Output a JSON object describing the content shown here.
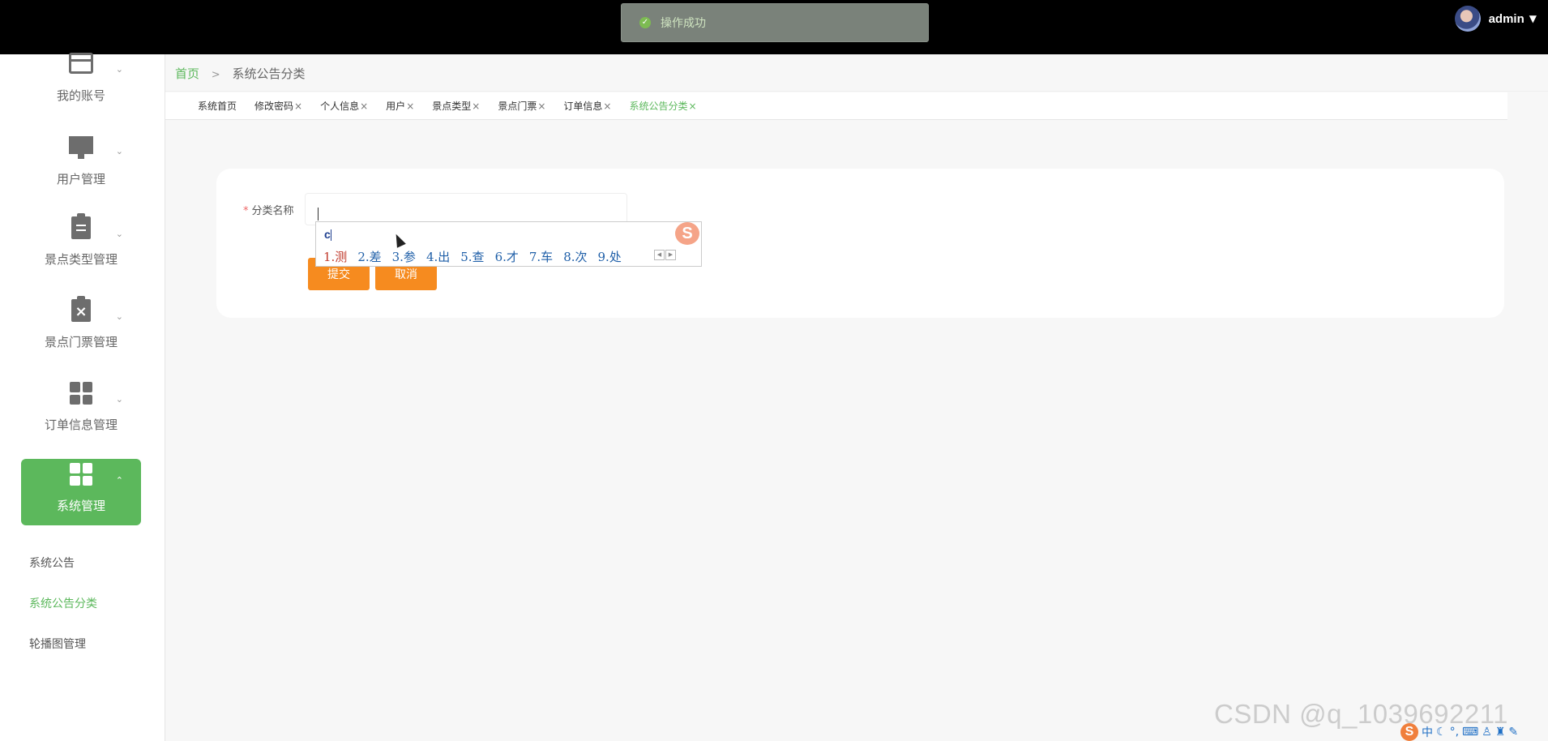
{
  "toast": {
    "text": "操作成功"
  },
  "user": {
    "name": "admin"
  },
  "sidebar": {
    "items": [
      {
        "label": "我的账号",
        "icon": "card-icon"
      },
      {
        "label": "用户管理",
        "icon": "monitor-icon"
      },
      {
        "label": "景点类型管理",
        "icon": "clipboard-icon"
      },
      {
        "label": "景点门票管理",
        "icon": "clipboard-x-icon"
      },
      {
        "label": "订单信息管理",
        "icon": "grid-icon"
      },
      {
        "label": "系统管理",
        "icon": "grid-icon",
        "active": true
      }
    ],
    "sub_items": [
      {
        "label": "系统公告"
      },
      {
        "label": "系统公告分类",
        "active": true
      },
      {
        "label": "轮播图管理"
      }
    ]
  },
  "breadcrumb": {
    "home": "首页",
    "separator": ">",
    "current": "系统公告分类"
  },
  "tabs": [
    {
      "label": "系统首页",
      "closable": false
    },
    {
      "label": "修改密码",
      "closable": true
    },
    {
      "label": "个人信息",
      "closable": true
    },
    {
      "label": "用户",
      "closable": true
    },
    {
      "label": "景点类型",
      "closable": true
    },
    {
      "label": "景点门票",
      "closable": true
    },
    {
      "label": "订单信息",
      "closable": true
    },
    {
      "label": "系统公告分类",
      "closable": true,
      "active": true
    }
  ],
  "tab_close_glyph": "×",
  "form": {
    "required_mark": "*",
    "category_label": "分类名称",
    "category_value": "",
    "submit_label": "提交",
    "cancel_label": "取消"
  },
  "ime": {
    "input": "c",
    "logo": "S",
    "candidates": [
      "1.测",
      "2.差",
      "3.参",
      "4.出",
      "5.查",
      "6.才",
      "7.车",
      "8.次",
      "9.处"
    ],
    "prev": "◀",
    "next": "▶"
  },
  "watermark": "CSDN @q_1039692211",
  "tray": {
    "logo": "S",
    "lang": "中"
  },
  "colors": {
    "accent": "#5cb85c",
    "button": "#f68b1f",
    "topbar": "#000000"
  }
}
